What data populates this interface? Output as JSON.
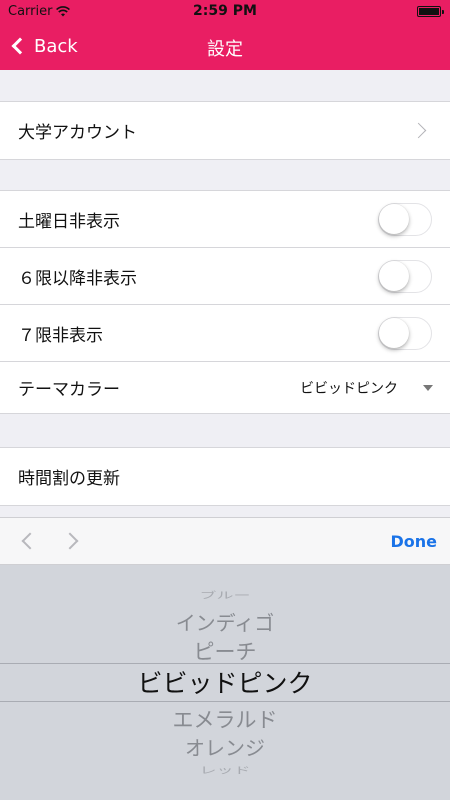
{
  "status_bar": {
    "carrier": "Carrier",
    "time": "2:59 PM"
  },
  "nav": {
    "back_label": "Back",
    "title": "設定"
  },
  "sections": {
    "account": {
      "label": "大学アカウント"
    },
    "display": {
      "saturday": {
        "label": "土曜日非表示",
        "on": false
      },
      "period6": {
        "label": "６限以降非表示",
        "on": false
      },
      "period7": {
        "label": "７限非表示",
        "on": false
      },
      "theme": {
        "label": "テーマカラー",
        "value": "ビビッドピンク"
      }
    },
    "update": {
      "label": "時間割の更新"
    }
  },
  "toolbar": {
    "done_label": "Done"
  },
  "picker": {
    "items": [
      "ブルー",
      "インディゴ",
      "ピーチ",
      "ビビッドピンク",
      "エメラルド",
      "オレンジ",
      "レッド"
    ],
    "selected": "ビビッドピンク"
  },
  "colors": {
    "accent": "#e91e63",
    "link": "#1a73e8"
  },
  "icons": [
    "wifi-icon",
    "battery-icon",
    "back-chevron-icon",
    "chevron-right-icon",
    "dropdown-icon",
    "prev-icon",
    "next-icon"
  ]
}
